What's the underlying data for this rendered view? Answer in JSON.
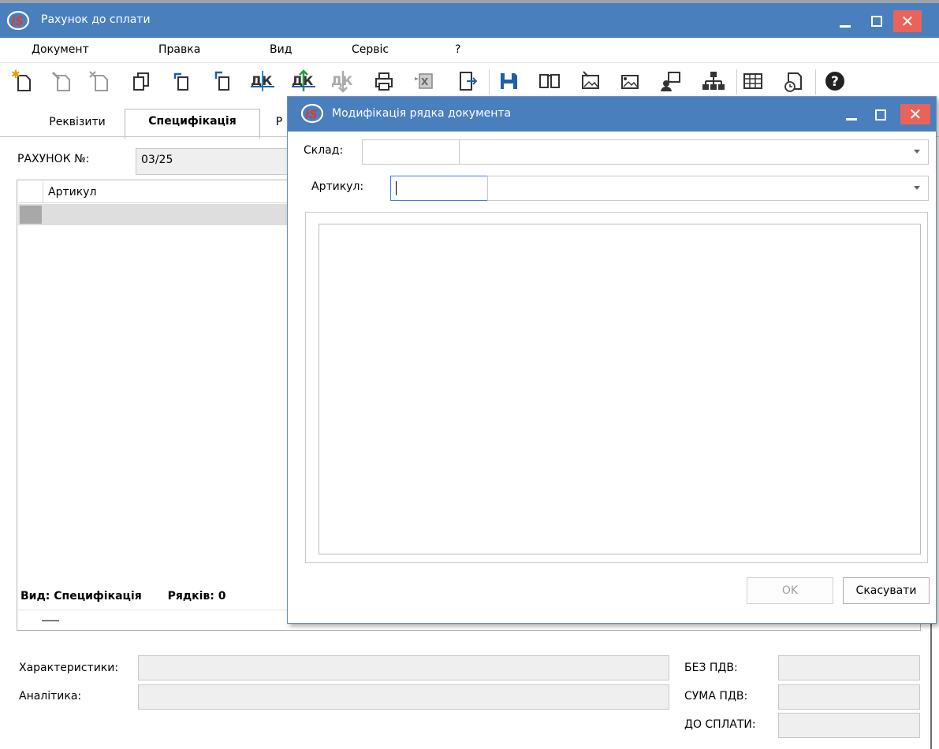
{
  "main_window": {
    "title": "Рахунок до сплати"
  },
  "menu": {
    "items": [
      "Документ",
      "Правка",
      "Вид",
      "Сервіс",
      "?"
    ]
  },
  "toolbar": {
    "icons": [
      "new-doc-icon",
      "edit-doc-icon",
      "delete-doc-icon",
      "copy-doc-icon",
      "doc-back-icon",
      "doc-forward-icon",
      "dk-icon",
      "dk-up-icon",
      "dk-down-icon",
      "print-icon",
      "excel-icon",
      "exit-icon",
      "save-icon",
      "book-icon",
      "image-doc-icon",
      "image-doc-2-icon",
      "users-icon",
      "tree-icon",
      "table-icon",
      "history-icon",
      "help-icon"
    ],
    "accent": "#1d5fa8"
  },
  "tabs": {
    "items": [
      "Реквізити",
      "Специфікація",
      "Р"
    ],
    "active": "Специфікація"
  },
  "invoice": {
    "number_label": "РАХУНОК №:",
    "number_value": "03/25"
  },
  "grid": {
    "column_header": "Артикул",
    "status_view": "Вид: Специфікація",
    "status_rows": "Рядків: 0"
  },
  "footer": {
    "characteristics_label": "Характеристики:",
    "analytics_label": "Аналітика:",
    "no_vat_label": "БЕЗ ПДВ:",
    "vat_sum_label": "СУМА ПДВ:",
    "to_pay_label": "ДО СПЛАТИ:"
  },
  "dialog": {
    "title": "Модифікація рядка документа",
    "warehouse_label": "Склад:",
    "article_label": "Артикул:",
    "ok_label": "OK",
    "cancel_label": "Скасувати"
  },
  "colors": {
    "titlebar": "#4a7fbd",
    "close": "#e8645a"
  }
}
